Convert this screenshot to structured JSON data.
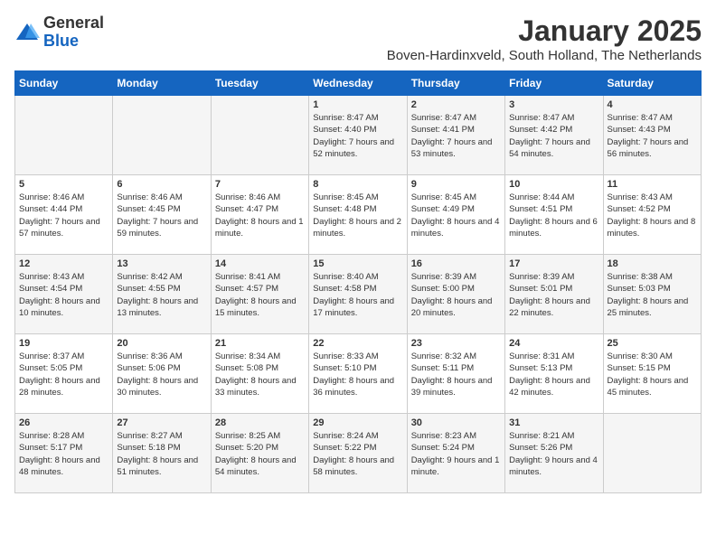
{
  "logo": {
    "general": "General",
    "blue": "Blue"
  },
  "title": "January 2025",
  "subtitle": "Boven-Hardinxveld, South Holland, The Netherlands",
  "header_days": [
    "Sunday",
    "Monday",
    "Tuesday",
    "Wednesday",
    "Thursday",
    "Friday",
    "Saturday"
  ],
  "weeks": [
    [
      {
        "day": "",
        "info": ""
      },
      {
        "day": "",
        "info": ""
      },
      {
        "day": "",
        "info": ""
      },
      {
        "day": "1",
        "info": "Sunrise: 8:47 AM\nSunset: 4:40 PM\nDaylight: 7 hours and 52 minutes."
      },
      {
        "day": "2",
        "info": "Sunrise: 8:47 AM\nSunset: 4:41 PM\nDaylight: 7 hours and 53 minutes."
      },
      {
        "day": "3",
        "info": "Sunrise: 8:47 AM\nSunset: 4:42 PM\nDaylight: 7 hours and 54 minutes."
      },
      {
        "day": "4",
        "info": "Sunrise: 8:47 AM\nSunset: 4:43 PM\nDaylight: 7 hours and 56 minutes."
      }
    ],
    [
      {
        "day": "5",
        "info": "Sunrise: 8:46 AM\nSunset: 4:44 PM\nDaylight: 7 hours and 57 minutes."
      },
      {
        "day": "6",
        "info": "Sunrise: 8:46 AM\nSunset: 4:45 PM\nDaylight: 7 hours and 59 minutes."
      },
      {
        "day": "7",
        "info": "Sunrise: 8:46 AM\nSunset: 4:47 PM\nDaylight: 8 hours and 1 minute."
      },
      {
        "day": "8",
        "info": "Sunrise: 8:45 AM\nSunset: 4:48 PM\nDaylight: 8 hours and 2 minutes."
      },
      {
        "day": "9",
        "info": "Sunrise: 8:45 AM\nSunset: 4:49 PM\nDaylight: 8 hours and 4 minutes."
      },
      {
        "day": "10",
        "info": "Sunrise: 8:44 AM\nSunset: 4:51 PM\nDaylight: 8 hours and 6 minutes."
      },
      {
        "day": "11",
        "info": "Sunrise: 8:43 AM\nSunset: 4:52 PM\nDaylight: 8 hours and 8 minutes."
      }
    ],
    [
      {
        "day": "12",
        "info": "Sunrise: 8:43 AM\nSunset: 4:54 PM\nDaylight: 8 hours and 10 minutes."
      },
      {
        "day": "13",
        "info": "Sunrise: 8:42 AM\nSunset: 4:55 PM\nDaylight: 8 hours and 13 minutes."
      },
      {
        "day": "14",
        "info": "Sunrise: 8:41 AM\nSunset: 4:57 PM\nDaylight: 8 hours and 15 minutes."
      },
      {
        "day": "15",
        "info": "Sunrise: 8:40 AM\nSunset: 4:58 PM\nDaylight: 8 hours and 17 minutes."
      },
      {
        "day": "16",
        "info": "Sunrise: 8:39 AM\nSunset: 5:00 PM\nDaylight: 8 hours and 20 minutes."
      },
      {
        "day": "17",
        "info": "Sunrise: 8:39 AM\nSunset: 5:01 PM\nDaylight: 8 hours and 22 minutes."
      },
      {
        "day": "18",
        "info": "Sunrise: 8:38 AM\nSunset: 5:03 PM\nDaylight: 8 hours and 25 minutes."
      }
    ],
    [
      {
        "day": "19",
        "info": "Sunrise: 8:37 AM\nSunset: 5:05 PM\nDaylight: 8 hours and 28 minutes."
      },
      {
        "day": "20",
        "info": "Sunrise: 8:36 AM\nSunset: 5:06 PM\nDaylight: 8 hours and 30 minutes."
      },
      {
        "day": "21",
        "info": "Sunrise: 8:34 AM\nSunset: 5:08 PM\nDaylight: 8 hours and 33 minutes."
      },
      {
        "day": "22",
        "info": "Sunrise: 8:33 AM\nSunset: 5:10 PM\nDaylight: 8 hours and 36 minutes."
      },
      {
        "day": "23",
        "info": "Sunrise: 8:32 AM\nSunset: 5:11 PM\nDaylight: 8 hours and 39 minutes."
      },
      {
        "day": "24",
        "info": "Sunrise: 8:31 AM\nSunset: 5:13 PM\nDaylight: 8 hours and 42 minutes."
      },
      {
        "day": "25",
        "info": "Sunrise: 8:30 AM\nSunset: 5:15 PM\nDaylight: 8 hours and 45 minutes."
      }
    ],
    [
      {
        "day": "26",
        "info": "Sunrise: 8:28 AM\nSunset: 5:17 PM\nDaylight: 8 hours and 48 minutes."
      },
      {
        "day": "27",
        "info": "Sunrise: 8:27 AM\nSunset: 5:18 PM\nDaylight: 8 hours and 51 minutes."
      },
      {
        "day": "28",
        "info": "Sunrise: 8:25 AM\nSunset: 5:20 PM\nDaylight: 8 hours and 54 minutes."
      },
      {
        "day": "29",
        "info": "Sunrise: 8:24 AM\nSunset: 5:22 PM\nDaylight: 8 hours and 58 minutes."
      },
      {
        "day": "30",
        "info": "Sunrise: 8:23 AM\nSunset: 5:24 PM\nDaylight: 9 hours and 1 minute."
      },
      {
        "day": "31",
        "info": "Sunrise: 8:21 AM\nSunset: 5:26 PM\nDaylight: 9 hours and 4 minutes."
      },
      {
        "day": "",
        "info": ""
      }
    ]
  ]
}
